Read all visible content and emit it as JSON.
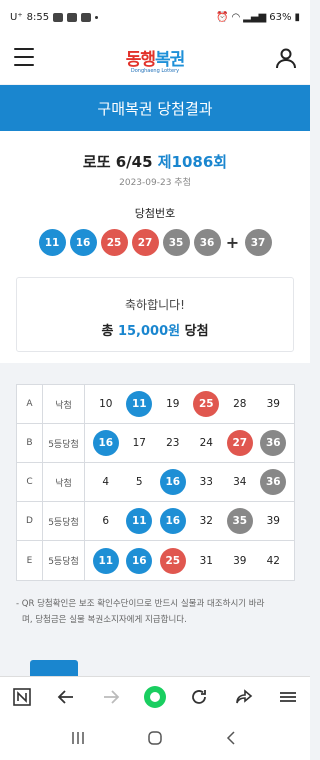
{
  "status_bar": {
    "carrier": "U⁺",
    "time": "8:55",
    "battery": "63%"
  },
  "header": {
    "logo_part1": "동행",
    "logo_part2": "복권",
    "logo_sub": "Donghaeng Lottery"
  },
  "banner": {
    "title": "구매복권 당첨결과"
  },
  "draw": {
    "game": "로또 6/45",
    "round": "제1086회",
    "date": "2023-09-23 추첨",
    "winning_label": "당첨번호",
    "numbers": [
      "11",
      "16",
      "25",
      "27",
      "35",
      "36"
    ],
    "bonus": "37",
    "plus": "+"
  },
  "prize": {
    "message": "축하합니다!",
    "prefix": "총",
    "amount": "15,000원",
    "suffix": "당첨"
  },
  "tickets": [
    {
      "id": "A",
      "result": "낙첨",
      "numbers": [
        "10",
        "11",
        "19",
        "25",
        "28",
        "39"
      ]
    },
    {
      "id": "B",
      "result": "5등당첨",
      "numbers": [
        "16",
        "17",
        "23",
        "24",
        "27",
        "36"
      ]
    },
    {
      "id": "C",
      "result": "낙첨",
      "numbers": [
        "4",
        "5",
        "16",
        "33",
        "34",
        "36"
      ]
    },
    {
      "id": "D",
      "result": "5등당첨",
      "numbers": [
        "6",
        "11",
        "16",
        "32",
        "35",
        "39"
      ]
    },
    {
      "id": "E",
      "result": "5등당첨",
      "numbers": [
        "11",
        "16",
        "25",
        "31",
        "39",
        "42"
      ]
    }
  ],
  "notice": {
    "line1": "- QR 당첨확인은 보조 확인수단이므로 반드시 실물과 대조하시기 바라",
    "line2": "며, 당첨금은 실물 복권소지자에게 지급합니다."
  },
  "colors": {
    "blue": "#1e8fd5",
    "red": "#e0574f",
    "gray": "#888888",
    "yellow": "#f1b82d",
    "green": "#6aba3a"
  }
}
